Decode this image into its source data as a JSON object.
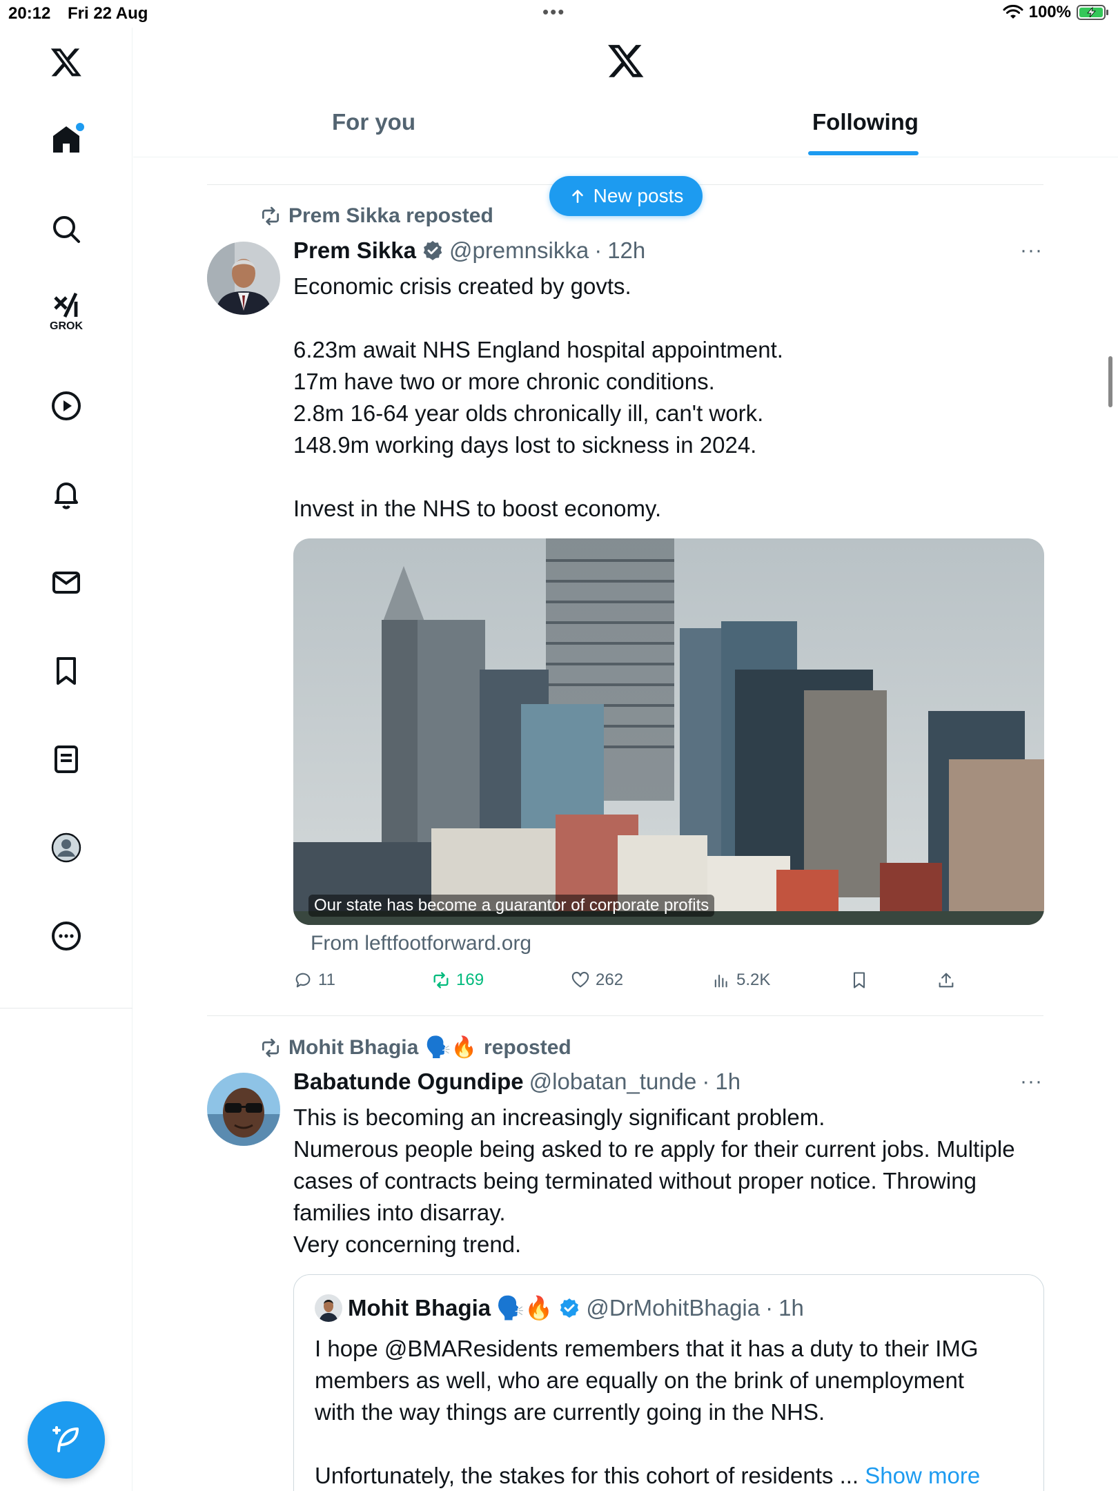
{
  "status_bar": {
    "time": "20:12",
    "date": "Fri 22 Aug",
    "dots": "•••",
    "battery_percent": "100%",
    "wifi_icon": "wifi-icon",
    "battery_icon": "battery-charging-icon"
  },
  "sidebar": {
    "items": [
      {
        "name": "x-logo",
        "icon": "x-logo-icon"
      },
      {
        "name": "home",
        "icon": "home-icon",
        "has_notification_dot": true
      },
      {
        "name": "search",
        "icon": "search-icon"
      },
      {
        "name": "grok",
        "icon": "grok-icon",
        "label": "GROK"
      },
      {
        "name": "videos",
        "icon": "play-icon"
      },
      {
        "name": "notifications",
        "icon": "bell-icon"
      },
      {
        "name": "messages",
        "icon": "mail-icon"
      },
      {
        "name": "bookmarks",
        "icon": "bookmark-icon"
      },
      {
        "name": "lists",
        "icon": "list-icon"
      },
      {
        "name": "profile",
        "icon": "profile-icon"
      },
      {
        "name": "more",
        "icon": "more-circle-icon"
      }
    ],
    "compose_icon": "compose-icon"
  },
  "header": {
    "logo": "x-logo-icon",
    "tabs": [
      {
        "label": "For you",
        "active": false
      },
      {
        "label": "Following",
        "active": true
      }
    ]
  },
  "new_posts_pill": {
    "label": "New posts",
    "icon": "arrow-up-icon"
  },
  "posts": [
    {
      "repost_by": "Prem Sikka reposted",
      "author_name": "Prem Sikka",
      "verified": true,
      "handle": "@premnsikka",
      "separator": "·",
      "time": "12h",
      "more": "···",
      "body": [
        "Economic crisis created by govts.",
        "",
        "6.23m await NHS England hospital appointment.",
        "17m have two or more chronic conditions.",
        "2.8m 16-64 year olds chronically ill, can't work.",
        "148.9m working days lost to sickness in 2024.",
        "",
        "Invest in the NHS to boost economy."
      ],
      "media_caption": "Our state has become a guarantor of corporate profits",
      "link_source": "From leftfootforward.org",
      "actions": {
        "replies": "11",
        "reposts": "169",
        "likes": "262",
        "views": "5.2K"
      }
    },
    {
      "repost_by_name": "Mohit Bhagia",
      "repost_by_emoji": "🗣️🔥",
      "repost_suffix": "reposted",
      "author_name": "Babatunde Ogundipe",
      "verified": false,
      "handle": "@lobatan_tunde",
      "separator": "·",
      "time": "1h",
      "more": "···",
      "body": [
        "This is becoming an increasingly significant problem.",
        "Numerous people being asked to re apply for their current jobs. Multiple",
        "cases of contracts being terminated without proper notice. Throwing",
        "families into disarray.",
        "Very concerning trend."
      ],
      "quote": {
        "author_name": "Mohit Bhagia",
        "author_emoji": "🗣️🔥",
        "verified": true,
        "handle": "@DrMohitBhagia",
        "separator": "·",
        "time": "1h",
        "body": [
          "I hope @BMAResidents remembers that it has a duty to their IMG",
          "members as well, who are equally on the brink of unemployment",
          "with the way things are currently going in the NHS.",
          ""
        ],
        "truncated_line": "Unfortunately, the stakes for this cohort of residents ...",
        "show_more": "Show more"
      }
    }
  ]
}
